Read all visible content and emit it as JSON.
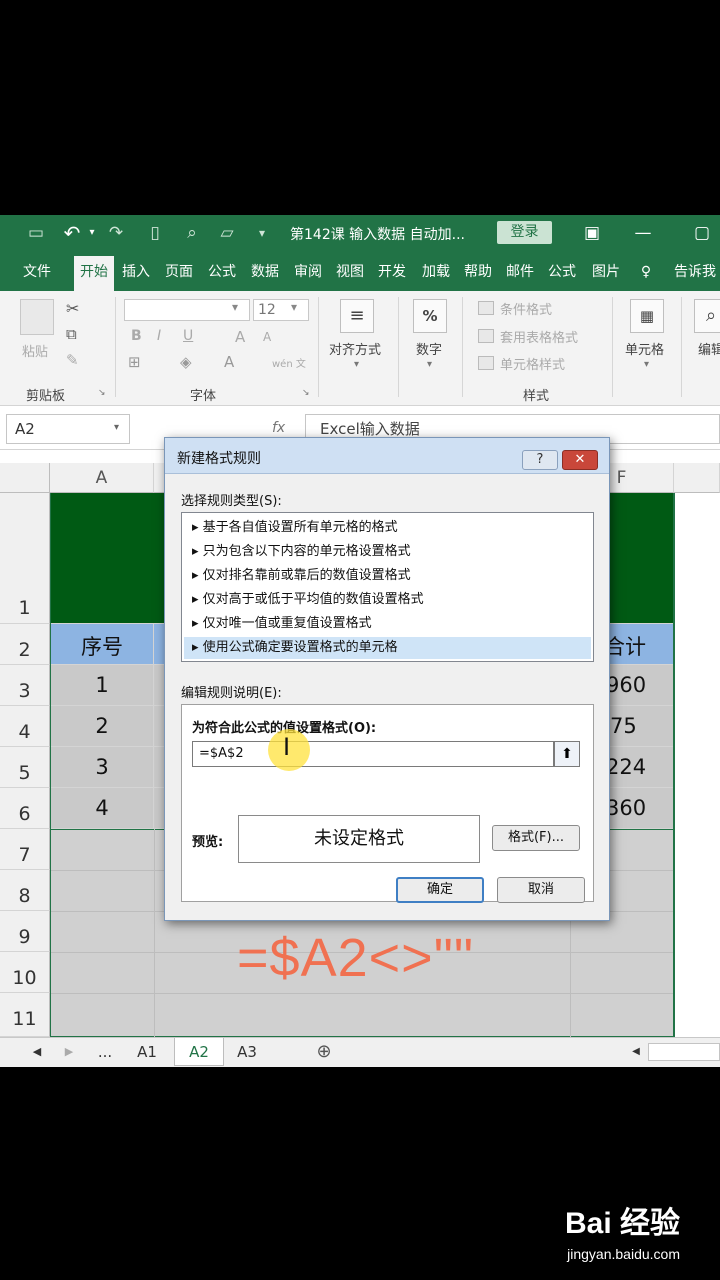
{
  "title_bar": {
    "document_title": "第142课 输入数据 自动加...",
    "login_label": "登录"
  },
  "ribbon_tabs": [
    "文件",
    "开始",
    "插入",
    "页面",
    "公式",
    "数据",
    "审阅",
    "视图",
    "开发",
    "加载",
    "帮助",
    "邮件",
    "公式",
    "图片",
    "告诉我"
  ],
  "ribbon": {
    "clipboard": {
      "paste_label": "粘贴",
      "group_label": "剪贴板"
    },
    "font": {
      "size_value": "12",
      "group_label": "字体",
      "bold": "B",
      "italic": "I",
      "underline": "U",
      "grow": "A",
      "shrink": "A",
      "wen": "wén 文"
    },
    "alignment": {
      "label": "对齐方式"
    },
    "number": {
      "label": "数字",
      "icon_text": "%"
    },
    "styles": {
      "conditional": "条件格式",
      "table": "套用表格格式",
      "cell_styles": "单元格样式",
      "group_label": "样式"
    },
    "cells": {
      "label": "单元格"
    },
    "editing": {
      "label": "编辑"
    }
  },
  "formula_bar": {
    "name_box": "A2",
    "formula_value": "Excel输入数据",
    "fx_label": "fx"
  },
  "grid": {
    "col_headers": [
      "A",
      "F"
    ],
    "row_headers": [
      "1",
      "2",
      "3",
      "4",
      "5",
      "6",
      "7",
      "8",
      "9",
      "10",
      "11"
    ],
    "header_cell_a": "序号",
    "header_cell_f": "合计",
    "serials": [
      "1",
      "2",
      "3",
      "4"
    ],
    "totals": [
      "960",
      "75",
      "224",
      "360"
    ]
  },
  "overlay_formula": "=$A2<>\"\"",
  "sheet_tabs": {
    "ellipsis": "...",
    "tabs": [
      "A1",
      "A2",
      "A3"
    ],
    "active": "A2",
    "add": "⊕"
  },
  "dialog": {
    "title": "新建格式规则",
    "help": "?",
    "close": "✕",
    "select_rule_type_label": "选择规则类型(S):",
    "rule_types": [
      "基于各自值设置所有单元格的格式",
      "只为包含以下内容的单元格设置格式",
      "仅对排名靠前或靠后的数值设置格式",
      "仅对高于或低于平均值的数值设置格式",
      "仅对唯一值或重复值设置格式",
      "使用公式确定要设置格式的单元格"
    ],
    "selected_rule_index": 5,
    "edit_rule_label": "编辑规则说明(E):",
    "formula_prompt": "为符合此公式的值设置格式(O):",
    "formula_value": "=$A$2",
    "preview_label": "预览:",
    "preview_text": "未设定格式",
    "format_button": "格式(F)...",
    "ok_button": "确定",
    "cancel_button": "取消"
  },
  "watermark": {
    "brand": "Bai 经验",
    "url": "jingyan.baidu.com"
  },
  "colors": {
    "excel_green": "#217346",
    "header_fill": "#005a14",
    "table_header_blue": "#8db4e2",
    "data_gray": "#c9c9c9",
    "overlay_orange": "#f07151"
  }
}
